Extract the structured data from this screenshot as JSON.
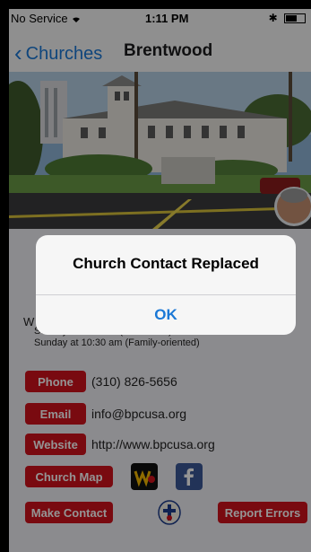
{
  "status_bar": {
    "carrier": "No Service",
    "time": "1:11 PM",
    "bluetooth": "✱"
  },
  "nav": {
    "back_label": "Churches",
    "title": "Brentwood"
  },
  "worship": {
    "lead": "W",
    "line1": "Sunday at 9:00 am (Traditional)",
    "line2": "Sunday at 10:30 am (Family-oriented)"
  },
  "contact": {
    "phone_label": "Phone",
    "phone_value": "(310) 826-5656",
    "email_label": "Email",
    "email_value": "info@bpcusa.org",
    "website_label": "Website",
    "website_value": "http://www.bpcusa.org",
    "map_label": "Church Map",
    "make_contact_label": "Make Contact",
    "report_errors_label": "Report Errors",
    "icons": [
      "walkup-icon",
      "facebook-icon",
      "denomination-seal-icon"
    ]
  },
  "alert": {
    "title": "Church Contact Replaced",
    "ok_label": "OK"
  },
  "colors": {
    "accent": "#1a78d6",
    "button_red": "#d0121c",
    "facebook_blue": "#3b5998"
  }
}
